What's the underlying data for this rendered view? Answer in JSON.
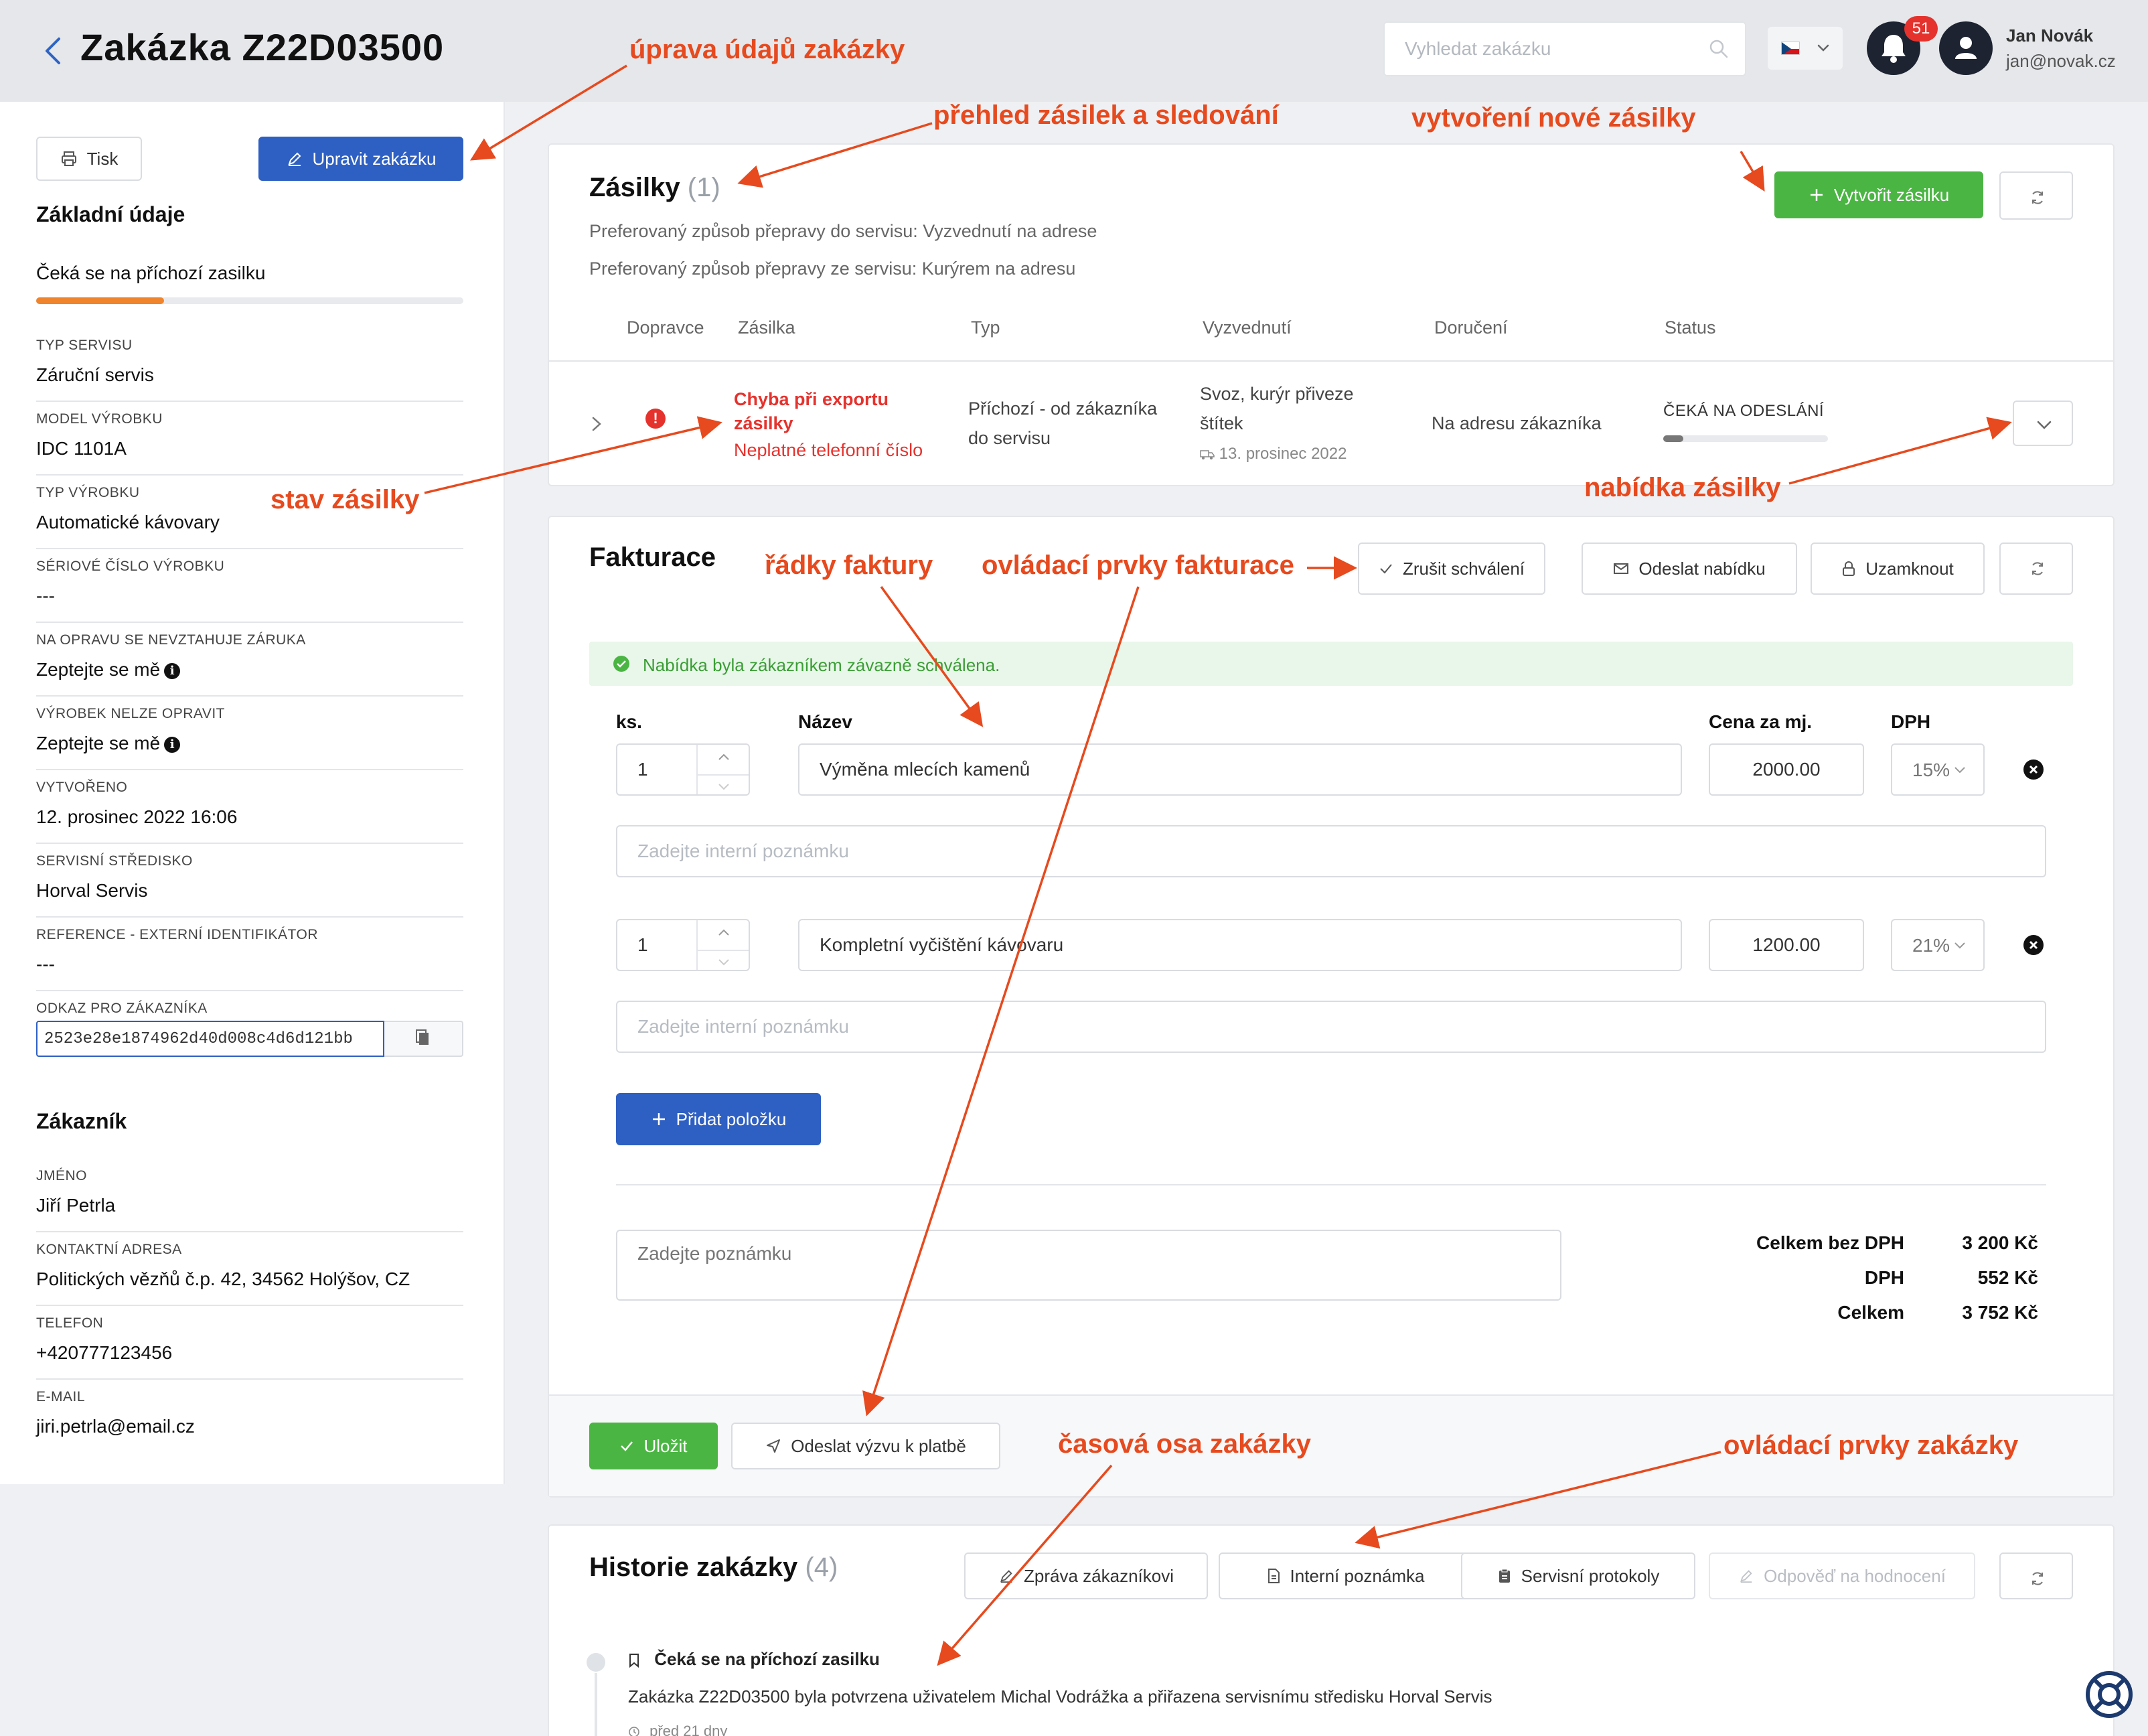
{
  "header": {
    "title": "Zakázka Z22D03500",
    "search_placeholder": "Vyhledat zakázku",
    "notification_count": "51",
    "user_name": "Jan Novák",
    "user_email": "jan@novak.cz"
  },
  "sidebar": {
    "print_label": "Tisk",
    "edit_label": "Upravit zakázku",
    "basic_title": "Základní údaje",
    "status_text": "Čeká se na příchozí zasilku",
    "status_progress": 0.3,
    "fields": [
      {
        "label": "Typ servisu",
        "value": "Záruční servis"
      },
      {
        "label": "Model výrobku",
        "value": "IDC 1101A"
      },
      {
        "label": "Typ výrobku",
        "value": "Automatické kávovary"
      },
      {
        "label": "Sériové číslo výrobku",
        "value": "---"
      },
      {
        "label": "Na opravu se nevztahuje záruka",
        "value": "Zeptejte se mě"
      },
      {
        "label": "Výrobek nelze opravit",
        "value": "Zeptejte se mě"
      },
      {
        "label": "Vytvořeno",
        "value": "12. prosinec 2022 16:06"
      },
      {
        "label": "Servisní středisko",
        "value": "Horval Servis"
      },
      {
        "label": "Reference - externí identifikátor",
        "value": "---"
      },
      {
        "label": "Odkaz pro zákazníka",
        "value": "2523e28e1874962d40d008c4d6d121bb"
      }
    ],
    "customer_title": "Zákazník",
    "customer": [
      {
        "label": "Jméno",
        "value": "Jiří Petrla"
      },
      {
        "label": "Kontaktní adresa",
        "value": "Politických vězňů č.p. 42, 34562 Holýšov, CZ"
      },
      {
        "label": "Telefon",
        "value": "+420777123456"
      },
      {
        "label": "E-mail",
        "value": "jiri.petrla@email.cz"
      }
    ]
  },
  "shipments": {
    "title": "Zásilky",
    "count": "(1)",
    "pref_to": "Preferovaný způsob přepravy do servisu: Vyzvednutí na adrese",
    "pref_from": "Preferovaný způsob přepravy ze servisu: Kurýrem na adresu",
    "create_label": "Vytvořit zásilku",
    "columns": [
      "Dopravce",
      "Zásilka",
      "Typ",
      "Vyzvednutí",
      "Doručení",
      "Status"
    ],
    "row": {
      "error_title_1": "Chyba při exportu",
      "error_title_2": "zásilky",
      "error_detail": "Neplatné telefonní číslo",
      "type_1": "Příchozí - od zákazníka",
      "type_2": "do servisu",
      "pickup_1": "Svoz, kurýr přiveze",
      "pickup_2": "štítek",
      "pickup_date": "13. prosinec 2022",
      "delivery": "Na adresu zákazníka",
      "status": "ČEKÁ NA ODESLÁNÍ",
      "status_progress": 0.12
    }
  },
  "invoice": {
    "title": "Fakturace",
    "cancel_approval": "Zrušit schválení",
    "send_offer": "Odeslat nabídku",
    "lock": "Uzamknout",
    "success_msg": "Nabídka byla zákazníkem závazně schválena.",
    "col_qty": "ks.",
    "col_name": "Název",
    "col_price": "Cena za mj.",
    "col_vat": "DPH",
    "note_placeholder": "Zadejte interní poznámku",
    "items": [
      {
        "qty": "1",
        "name": "Výměna mlecích kamenů",
        "price": "2000.00",
        "vat": "15%"
      },
      {
        "qty": "1",
        "name": "Kompletní vyčištění kávovaru",
        "price": "1200.00",
        "vat": "21%"
      }
    ],
    "add_item": "Přidat položku",
    "general_note_placeholder": "Zadejte poznámku",
    "totals": [
      {
        "label": "Celkem bez DPH",
        "value": "3 200 Kč"
      },
      {
        "label": "DPH",
        "value": "552 Kč"
      },
      {
        "label": "Celkem",
        "value": "3 752 Kč"
      }
    ],
    "save": "Uložit",
    "payment_request": "Odeslat výzvu k platbě"
  },
  "history": {
    "title": "Historie zakázky",
    "count": "(4)",
    "message_customer": "Zpráva zákazníkovi",
    "internal_note": "Interní poznámka",
    "service_protocols": "Servisní protokoly",
    "review_reply": "Odpověď na hodnocení",
    "event_title": "Čeká se na příchozí zasilku",
    "event_text": "Zakázka Z22D03500 byla potvrzena uživatelem Michal Vodrážka a přiřazena servisnímu středisku Horval Servis",
    "event_time": "před 21 dny"
  },
  "annotations": {
    "edit": "úprava údajů zakázky",
    "overview": "přehled zásilek a sledování",
    "new_shipment": "vytvoření nové zásilky",
    "shipment_state": "stav zásilky",
    "shipment_menu": "nabídka zásilky",
    "invoice_rows": "řádky faktury",
    "invoice_controls": "ovládací prvky fakturace",
    "timeline": "časová osa zakázky",
    "order_controls": "ovládací prvky zakázky"
  },
  "colors": {
    "primary": "#2e5fc2",
    "success": "#4bb543",
    "error": "#e5322d",
    "annotation": "#e64a1e",
    "progress": "#f0842c"
  }
}
